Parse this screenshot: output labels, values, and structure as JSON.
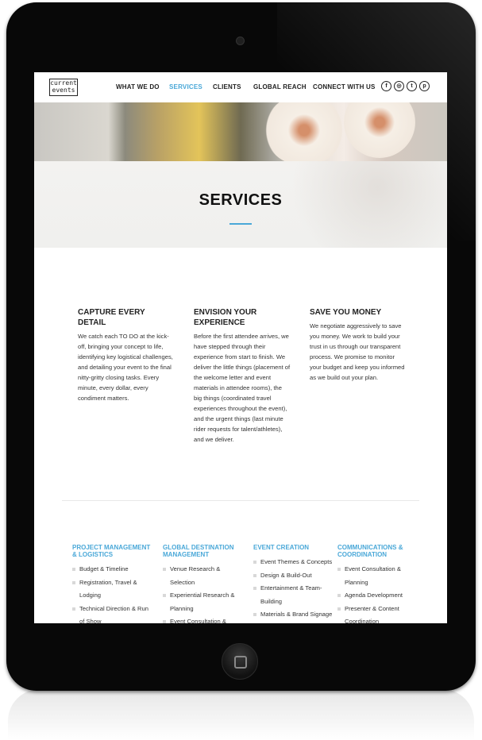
{
  "logo": {
    "line1": "current",
    "line2": "events"
  },
  "nav": {
    "items": [
      {
        "label": "WHAT WE DO"
      },
      {
        "label": "SERVICES"
      },
      {
        "label": "CLIENTS"
      },
      {
        "label": "GLOBAL REACH"
      },
      {
        "label": "CONNECT WITH US"
      }
    ],
    "social": [
      {
        "icon": "facebook-icon",
        "glyph": "f"
      },
      {
        "icon": "instagram-icon",
        "glyph": "◎"
      },
      {
        "icon": "twitter-icon",
        "glyph": "t"
      },
      {
        "icon": "pinterest-icon",
        "glyph": "p"
      }
    ]
  },
  "hero": {
    "title": "SERVICES"
  },
  "columns": [
    {
      "title": "CAPTURE EVERY DETAIL",
      "body": "We catch each TO DO at the kick-off, bringing your concept to life, identifying key logistical challenges, and detailing your event to the final nitty-gritty closing tasks. Every minute, every dollar, every condiment matters."
    },
    {
      "title": "ENVISION YOUR EXPERIENCE",
      "body": "Before the first attendee arrives, we have stepped through their experience from start to finish. We deliver the little things (placement of the welcome letter and event materials in attendee rooms), the big things (coordinated travel experiences throughout the event), and the urgent things (last minute rider requests for talent/athletes), and we deliver."
    },
    {
      "title": "SAVE YOU MONEY",
      "body": "We negotiate aggressively to save you money. We work to build your trust in us through our transparent process. We promise to monitor your budget and keep you informed as we build out your plan."
    }
  ],
  "lists": [
    {
      "title": "PROJECT MANAGEMENT & LOGISTICS",
      "items": [
        "Budget & Timeline",
        "Registration, Travel & Lodging",
        "Technical Direction & Run of Show"
      ]
    },
    {
      "title": "GLOBAL DESTINATION MANAGEMENT",
      "items": [
        "Venue Research & Selection",
        "Experiential Research & Planning",
        "Event Consultation &"
      ]
    },
    {
      "title": "EVENT CREATION",
      "items": [
        "Event Themes & Concepts",
        "Design & Build-Out",
        "Entertainment & Team-Building",
        "Materials & Brand Signage"
      ]
    },
    {
      "title": "COMMUNICATIONS & COORDINATION",
      "items": [
        "Event Consultation & Planning",
        "Agenda Development",
        "Presenter & Content Coordination"
      ]
    }
  ],
  "colors": {
    "accent": "#4aa8d8",
    "text": "#222222",
    "device": "#080808"
  }
}
